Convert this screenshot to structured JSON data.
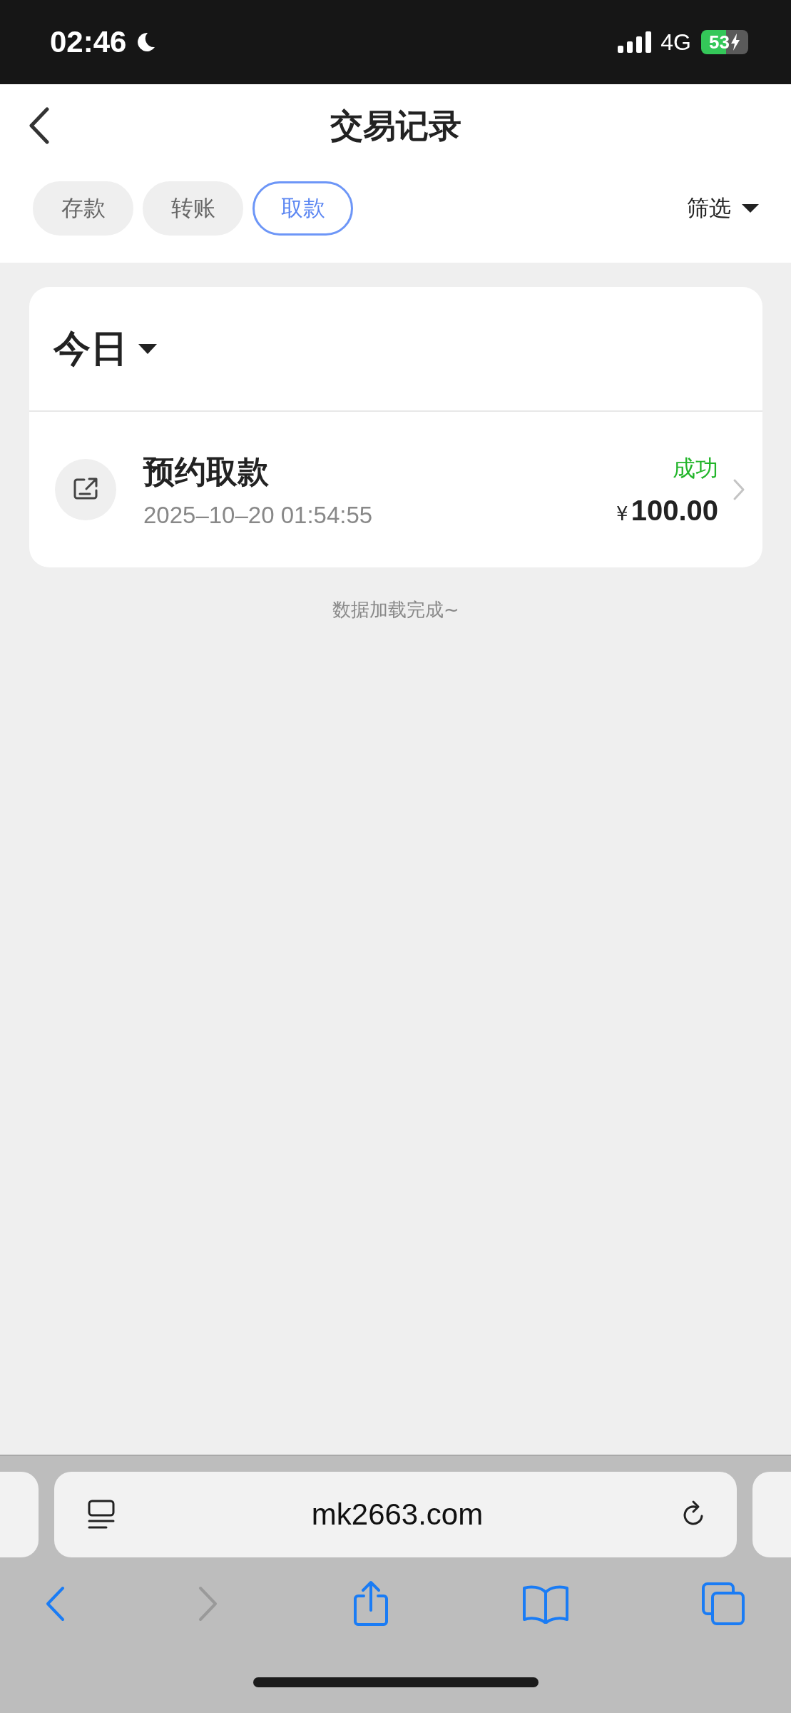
{
  "status_bar": {
    "time": "02:46",
    "network": "4G",
    "battery": "53"
  },
  "header": {
    "title": "交易记录"
  },
  "tabs": [
    {
      "label": "存款",
      "selected": false
    },
    {
      "label": "转账",
      "selected": false
    },
    {
      "label": "取款",
      "selected": true
    }
  ],
  "filter": {
    "label": "筛选"
  },
  "group": {
    "label": "今日"
  },
  "transactions": [
    {
      "title": "预约取款",
      "time": "2025–10–20 01:54:55",
      "status": "成功",
      "currency": "¥",
      "amount": "100.00"
    }
  ],
  "footer_note": "数据加载完成~",
  "browser": {
    "url": "mk2663.com"
  }
}
